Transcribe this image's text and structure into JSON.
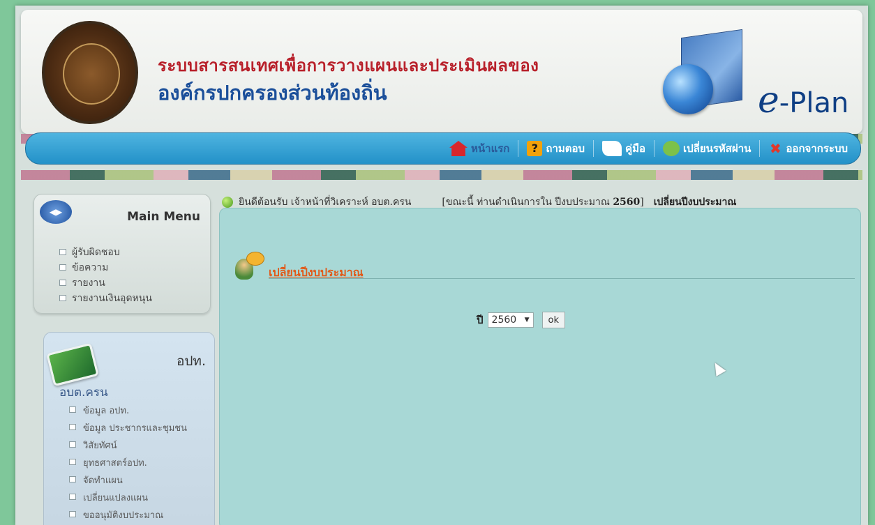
{
  "header": {
    "title_line1": "ระบบสารสนเทศเพื่อการวางแผนและประเมินผลของ",
    "title_line2": "องค์กรปกครองส่วนท้องถิ่น",
    "brand": "-Plan",
    "brand_e": "e"
  },
  "nav": {
    "items": [
      {
        "label": "หน้าแรก",
        "icon": "home-icon"
      },
      {
        "label": "ถามตอบ",
        "icon": "help-icon"
      },
      {
        "label": "คู่มือ",
        "icon": "manual-icon"
      },
      {
        "label": "เปลี่ยนรหัสผ่าน",
        "icon": "key-icon"
      },
      {
        "label": "ออกจากระบบ",
        "icon": "logout-icon"
      }
    ]
  },
  "main_menu": {
    "title": "Main Menu",
    "items": [
      "ผู้รับผิดชอบ",
      "ข้อความ",
      "รายงาน",
      "รายงานเงินอุดหนุน"
    ]
  },
  "org_menu": {
    "title": "อปท.",
    "org_name": "อบต.ครน",
    "items": [
      "ข้อมูล อปท.",
      "ข้อมูล ประชากรและชุมชน",
      "วิสัยทัศน์",
      "ยุทธศาสตร์อปท.",
      "จัดทำแผน",
      "เปลี่ยนแปลงแผน",
      "ขออนุมัติงบประมาณ"
    ]
  },
  "welcome": {
    "text": "ยินดีต้อนรับ เจ้าหน้าที่วิเคราะห์ อบต.ครน",
    "status_prefix": "[ขณะนี้ ท่านดำเนินการใน ปีงบประมาณ",
    "year": "2560",
    "status_suffix": "]",
    "change_link": "เปลี่ยนปีงบประมาณ"
  },
  "content": {
    "section_title": "เปลี่ยนปีงบประมาณ",
    "year_label": "ปี",
    "year_value": "2560",
    "ok_label": "ok"
  }
}
